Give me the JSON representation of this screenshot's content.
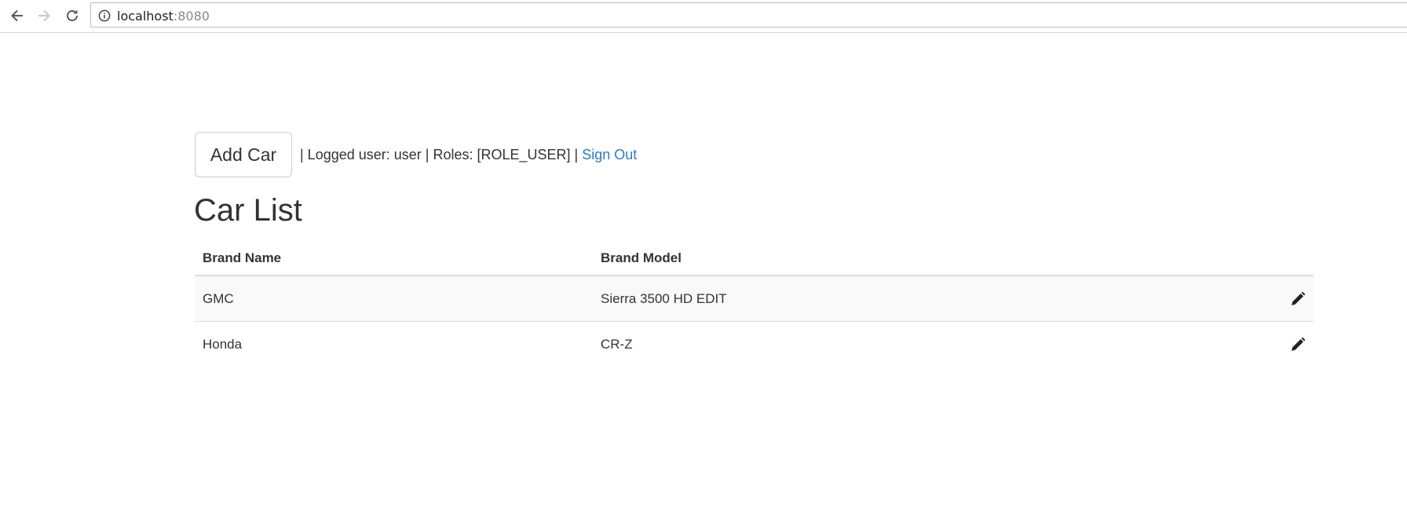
{
  "browser": {
    "url_host": "localhost",
    "url_port": ":8080"
  },
  "toolbar": {
    "add_label": "Add Car",
    "user_info": " | Logged user: user | Roles: [ROLE_USER] | ",
    "sign_out_label": "Sign Out"
  },
  "page": {
    "title": "Car List"
  },
  "table": {
    "headers": [
      "Brand Name",
      "Brand Model"
    ],
    "rows": [
      {
        "brand": "GMC",
        "model": "Sierra 3500 HD EDIT",
        "action_icon": "pencil-icon"
      },
      {
        "brand": "Honda",
        "model": "CR-Z",
        "action_icon": "pencil-icon"
      }
    ]
  },
  "colors": {
    "link": "#337ab7",
    "text": "#333333",
    "stripe": "#f9f9f9",
    "border": "#dddddd"
  }
}
